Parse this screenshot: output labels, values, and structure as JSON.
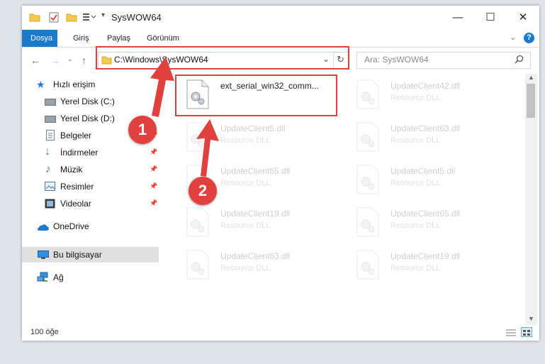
{
  "window": {
    "title": "SysWOW64",
    "controls": {
      "minimize": "—",
      "maximize": "☐",
      "close": "✕"
    }
  },
  "ribbon": {
    "tabs": [
      {
        "label": "Dosya",
        "active": true
      },
      {
        "label": "Giriş"
      },
      {
        "label": "Paylaş"
      },
      {
        "label": "Görünüm"
      }
    ],
    "help": "?"
  },
  "nav": {
    "address": "C:\\Windows\\SysWOW64",
    "search_placeholder": "Ara: SysWOW64"
  },
  "sidebar": {
    "items": [
      {
        "label": "Hızlı erişim",
        "icon": "star-icon"
      },
      {
        "label": "Yerel Disk (C:)",
        "icon": "drive-icon",
        "pinned": true
      },
      {
        "label": "Yerel Disk (D:)",
        "icon": "drive-icon",
        "pinned": true
      },
      {
        "label": "Belgeler",
        "icon": "document-icon",
        "pinned": true
      },
      {
        "label": "İndirmeler",
        "icon": "download-icon",
        "pinned": true
      },
      {
        "label": "Müzik",
        "icon": "music-icon",
        "pinned": true
      },
      {
        "label": "Resimler",
        "icon": "pictures-icon",
        "pinned": true
      },
      {
        "label": "Videolar",
        "icon": "video-icon",
        "pinned": true
      },
      {
        "label": "OneDrive",
        "icon": "cloud-icon"
      },
      {
        "label": "Bu bilgisayar",
        "icon": "computer-icon",
        "selected": true
      },
      {
        "label": "Ağ",
        "icon": "network-icon"
      }
    ]
  },
  "files": [
    {
      "name": "ext_serial_win32_comm...",
      "type": ""
    },
    {
      "name": "UpdateClient42.dll",
      "type": "Resource DLL"
    },
    {
      "name": "UpdateClient5.dll",
      "type": "Resource DLL"
    },
    {
      "name": "UpdateClient63.dll",
      "type": "Resource DLL"
    },
    {
      "name": "UpdateClient65.dll",
      "type": "Resource DLL"
    },
    {
      "name": "UpdateClient5.dll",
      "type": "Resource DLL"
    },
    {
      "name": "UpdateClient19.dll",
      "type": "Resource DLL"
    },
    {
      "name": "UpdateClient65.dll",
      "type": "Resource DLL"
    },
    {
      "name": "UpdateClient63.dll",
      "type": "Resource DLL"
    },
    {
      "name": "UpdateClient19.dll",
      "type": "Resource DLL"
    }
  ],
  "status": {
    "count": "100 öğe"
  },
  "annotations": {
    "marker1": "1",
    "marker2": "2",
    "color": "#e0413f"
  }
}
